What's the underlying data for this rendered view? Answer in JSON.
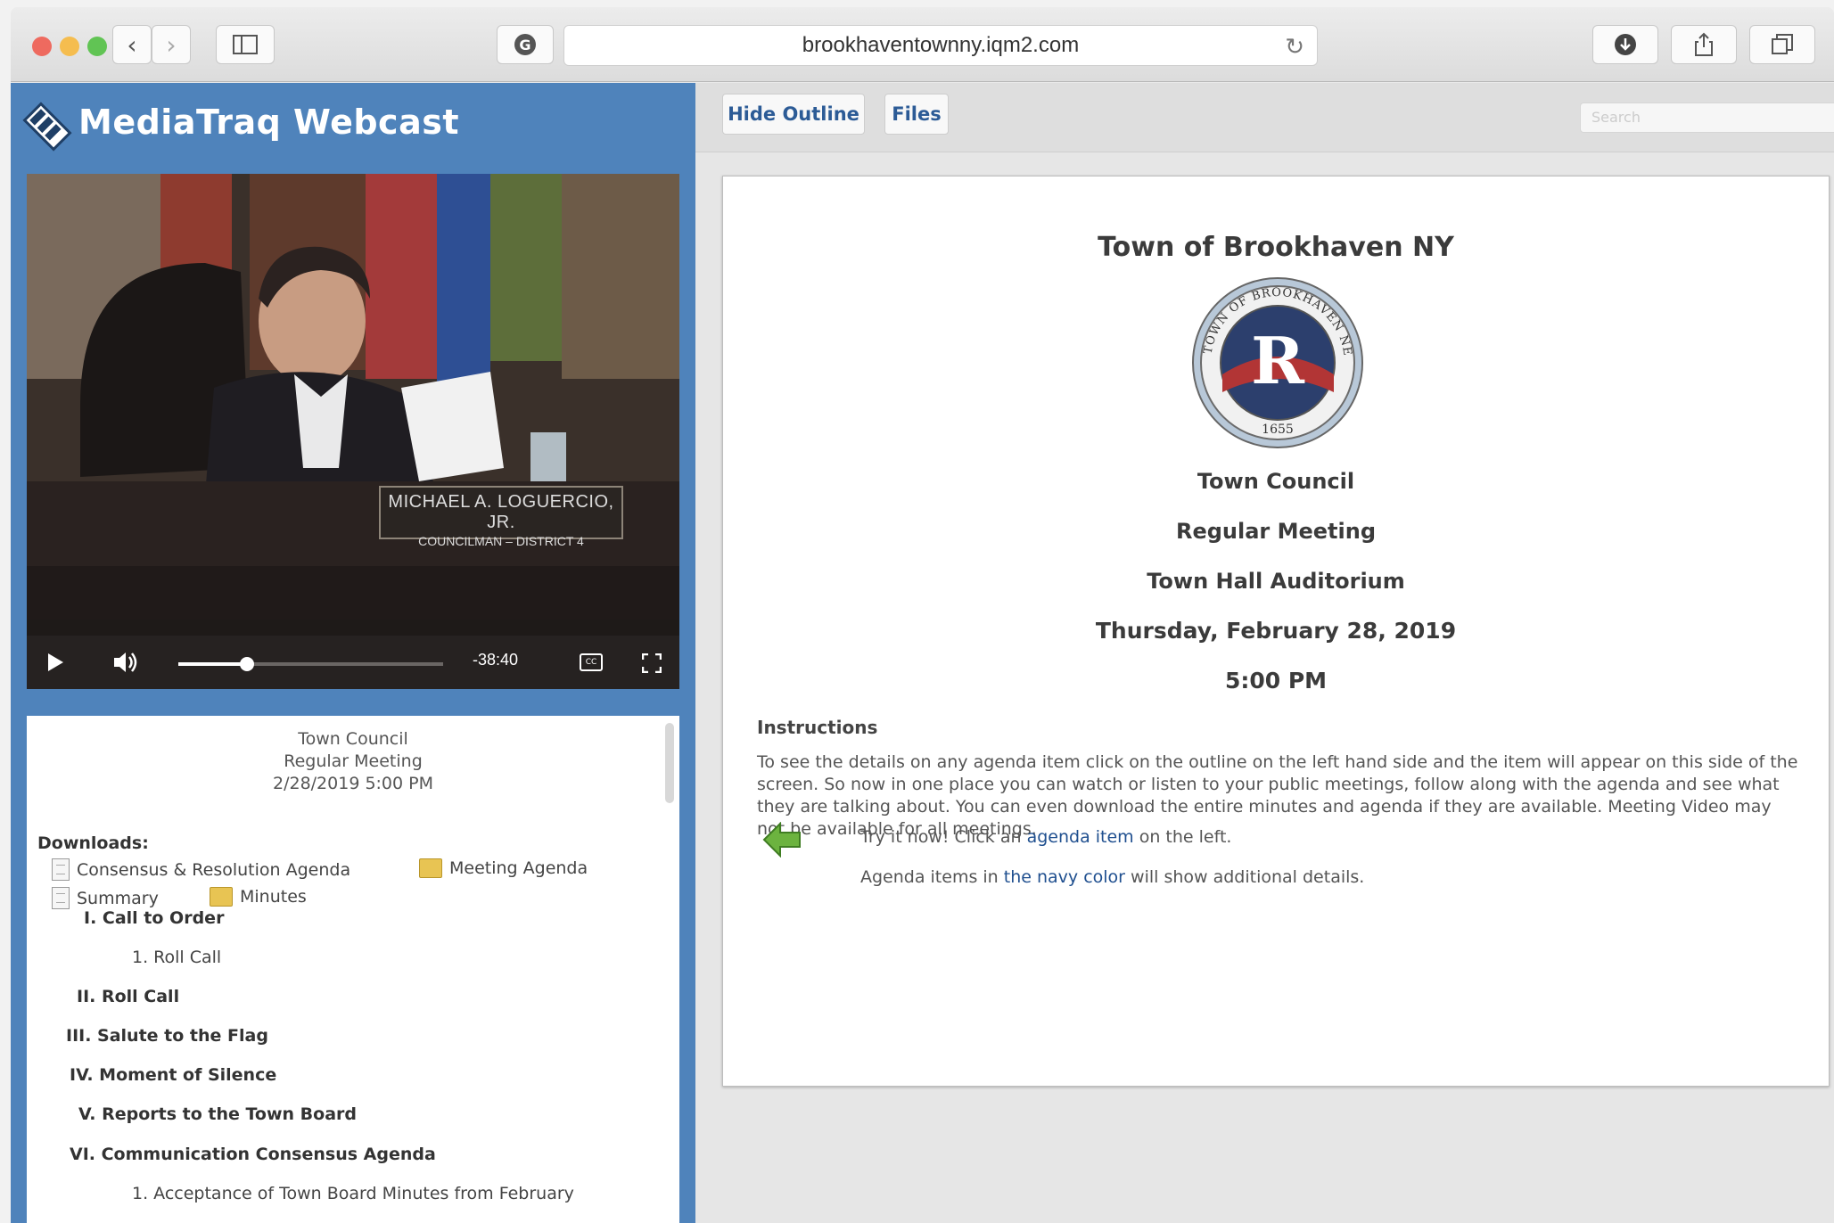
{
  "browser": {
    "url": "brookhaventownny.iqm2.com"
  },
  "app": {
    "title": "MediaTraq Webcast"
  },
  "video": {
    "nameplate_name": "MICHAEL A. LOGUERCIO, JR.",
    "nameplate_title": "COUNCILMAN – DISTRICT 4",
    "time_remaining": "-38:40",
    "cc_label": "CC",
    "progress_fraction": 0.26
  },
  "outline": {
    "header": [
      "Town Council",
      "Regular Meeting",
      "2/28/2019 5:00 PM"
    ],
    "downloads_label": "Downloads:",
    "downloads": [
      "Consensus & Resolution Agenda",
      "Meeting Agenda",
      "Summary",
      "Minutes"
    ],
    "items": [
      {
        "text": "I. Call to Order",
        "level": 1
      },
      {
        "text": "1. Roll Call",
        "level": 2
      },
      {
        "text": "II. Roll Call",
        "level": 1
      },
      {
        "text": "III. Salute to the Flag",
        "level": 1
      },
      {
        "text": "IV. Moment of Silence",
        "level": 1
      },
      {
        "text": "V. Reports to the Town Board",
        "level": 1
      },
      {
        "text": "VI. Communication Consensus Agenda",
        "level": 1
      },
      {
        "text": "1. Acceptance of Town Board Minutes from February",
        "level": 2
      }
    ]
  },
  "toolbar": {
    "hide_outline": "Hide Outline",
    "files": "Files",
    "search_placeholder": "Search"
  },
  "meeting": {
    "org": "Town of Brookhaven NY",
    "body": "Town Council",
    "type": "Regular Meeting",
    "location": "Town Hall Auditorium",
    "date": "Thursday, February 28, 2019",
    "time": "5:00 PM",
    "seal_text": "TOWN OF BROOKHAVEN NEW YORK",
    "seal_year": "1655"
  },
  "instructions": {
    "title": "Instructions",
    "body": "To see the details on any agenda item click on the outline on the left hand side and the item will appear on this side of the screen. So now in one place you can watch or listen to your public meetings, follow along with the agenda and see what they are talking about. You can even download the entire minutes and agenda if they are available. Meeting Video may not be available for all meetings.",
    "try_prefix": "Try it now! Click an ",
    "try_link": "agenda item",
    "try_suffix": " on the left.",
    "navy_prefix": "Agenda items in ",
    "navy_link": "the navy color",
    "navy_suffix": " will show additional details."
  },
  "colors": {
    "panel_blue": "#4f83bb",
    "navy_link": "#1f4f8f",
    "button_text": "#2c5b96"
  }
}
